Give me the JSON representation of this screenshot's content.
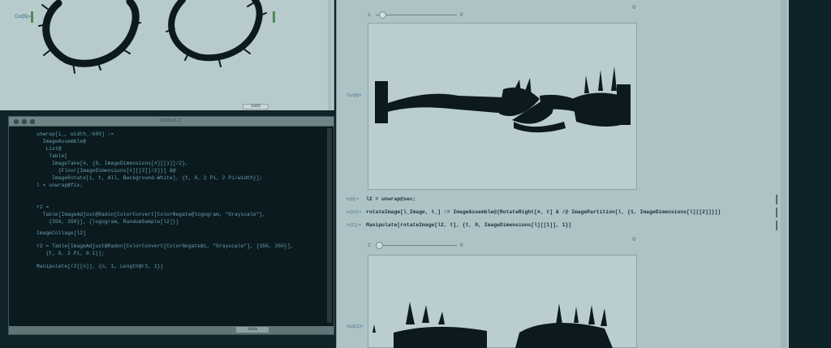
{
  "top_notebook": {
    "output_label": "Out[6]=",
    "zoom": "100%"
  },
  "editor": {
    "title": "Untitled-1*",
    "code_lines": [
      "unwrap[i_, width_:600] :=",
      "  ImageAssemble@",
      "   List@",
      "    Table[",
      "     ImageTake[#, {0, ImageDimensions[#][[1]]/2},",
      "       {Floor[ImageDimensions[#][[2]]/2]}] &@",
      "     ImageRotate[i, t, All, Background→White], {t, 0, 2 Pi, 2 Pi/width}];",
      "l = unwrap@fix;",
      "",
      "",
      "r2 =",
      "  Table[ImageAdjust@Radon[ColorConvert[ColorNegate@logogram, \"Grayscale\"],",
      "    {350, 350}], {logogram, RandomSample[l2]}]",
      "",
      "ImageCollage[l2]",
      "",
      "r2 = Table[ImageAdjust@Radon[ColorConvert[ColorNegate@i, \"Grayscale\"], {350, 350}],",
      "   {t, 0, 2 Pi, 0.1}];",
      "",
      "Manipulate[r2[[n]], {n, 1, Length@r2, 1}]"
    ],
    "zoom": "100%"
  },
  "right_notebook": {
    "slider1": {
      "min": "1",
      "max": "0"
    },
    "output_label_1": "Out[8]=",
    "in_labels": [
      "In[9]:=",
      "In[10]:=",
      "In[11]:="
    ],
    "in_code": [
      "l2 = unwrap@sec;",
      "rotateImage[l_Image, t_] := ImageAssemble@{RotateRight[#, t] & /@ ImagePartition[l, {1, ImageDimensions[l][[2]]}]}",
      "Manipulate[rotateImage[l2, t], {t, 0, ImageDimensions[l][[1]], 1}]"
    ],
    "slider2": {
      "min": "1",
      "max": "0"
    },
    "output_label_2": "Out[11]="
  }
}
